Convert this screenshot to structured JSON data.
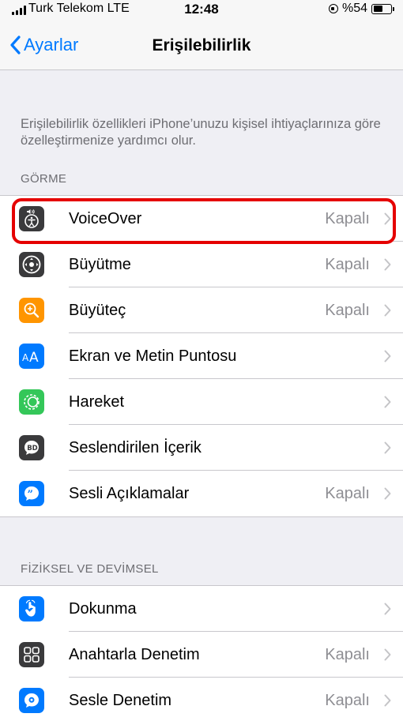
{
  "status_bar": {
    "carrier": "Turk Telekom  LTE",
    "time": "12:48",
    "battery": "%54",
    "battery_level": 0.54
  },
  "nav": {
    "back_label": "Ayarlar",
    "title": "Erişilebilirlik"
  },
  "description": "Erişilebilirlik özellikleri iPhone’unuzu kişisel ihtiyaçlarınıza göre özelleştirmenize yardımcı olur.",
  "sections": [
    {
      "header": "GÖRME",
      "items": [
        {
          "label": "VoiceOver",
          "value": "Kapalı",
          "icon": "voiceover-icon",
          "color": "#1c1c1e"
        },
        {
          "label": "Büyütme",
          "value": "Kapalı",
          "icon": "zoom-icon",
          "color": "#1c1c1e"
        },
        {
          "label": "Büyüteç",
          "value": "Kapalı",
          "icon": "magnifier-icon",
          "color": "#ff9500"
        },
        {
          "label": "Ekran ve Metin Puntosu",
          "value": "",
          "icon": "text-size-icon",
          "color": "#007aff"
        },
        {
          "label": "Hareket",
          "value": "",
          "icon": "motion-icon",
          "color": "#34c759"
        },
        {
          "label": "Seslendirilen İçerik",
          "value": "",
          "icon": "spoken-content-icon",
          "color": "#1c1c1e"
        },
        {
          "label": "Sesli Açıklamalar",
          "value": "Kapalı",
          "icon": "audio-descriptions-icon",
          "color": "#007aff"
        }
      ]
    },
    {
      "header": "FİZİKSEL VE DEVİMSEL",
      "items": [
        {
          "label": "Dokunma",
          "value": "",
          "icon": "touch-icon",
          "color": "#007aff"
        },
        {
          "label": "Anahtarla Denetim",
          "value": "Kapalı",
          "icon": "switch-control-icon",
          "color": "#1c1c1e"
        },
        {
          "label": "Sesle Denetim",
          "value": "Kapalı",
          "icon": "voice-control-icon",
          "color": "#007aff"
        }
      ]
    }
  ],
  "highlight_color": "#e50000"
}
